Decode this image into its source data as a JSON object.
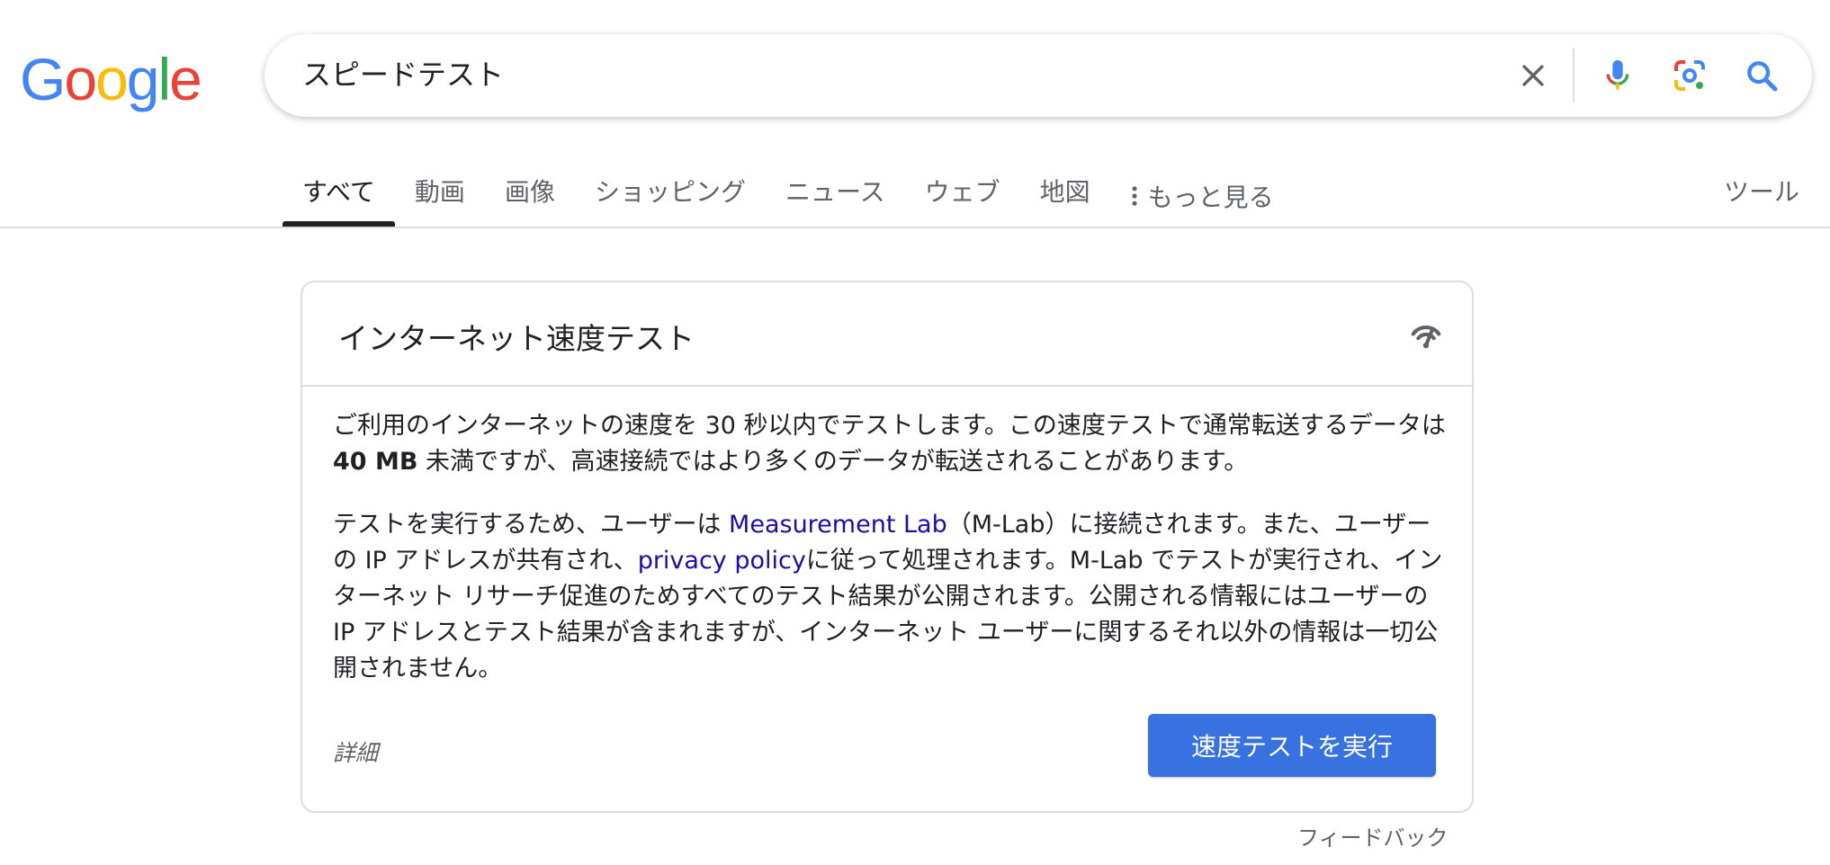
{
  "logo": {
    "text": [
      "G",
      "o",
      "o",
      "g",
      "l",
      "e"
    ]
  },
  "search": {
    "query": "スピードテスト"
  },
  "tabs": [
    {
      "label": "すべて"
    },
    {
      "label": "動画"
    },
    {
      "label": "画像"
    },
    {
      "label": "ショッピング"
    },
    {
      "label": "ニュース"
    },
    {
      "label": "ウェブ"
    },
    {
      "label": "地図"
    }
  ],
  "more_label": "もっと見る",
  "tools_label": "ツール",
  "card": {
    "title": "インターネット速度テスト",
    "p1": {
      "a": "ご利用のインターネットの速度を 30 秒以内でテストします。この速度テストで通常転送するデータは ",
      "bold": "40 MB",
      "b": " 未満ですが、高速接続ではより多くのデータが転送されることがあります。"
    },
    "p2": {
      "a": "テストを実行するため、ユーザーは ",
      "link1": "Measurement Lab",
      "b": "（M-Lab）に接続されます。また、ユーザーの IP アドレスが共有され、",
      "link2": "privacy policy",
      "c": "に従って処理されます。M-Lab でテストが実行され、インターネット リサーチ促進のためすべてのテスト結果が公開されます。公開される情報にはユーザーの IP アドレスとテスト結果が含まれますが、インターネット ユーザーに関するそれ以外の情報は一切公開されません。"
    },
    "details_label": "詳細",
    "run_button": "速度テストを実行"
  },
  "feedback_label": "フィードバック"
}
